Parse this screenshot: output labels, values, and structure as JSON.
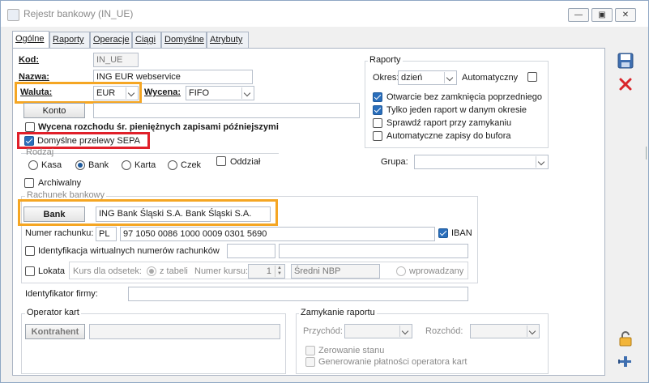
{
  "window": {
    "title": "Rejestr bankowy (IN_UE)"
  },
  "tabs": [
    "Ogólne",
    "Raporty",
    "Operacje",
    "Ciągi",
    "Domyślne",
    "Atrybuty"
  ],
  "form": {
    "kod_label": "Kod:",
    "kod_value": "IN_UE",
    "nazwa_label": "Nazwa:",
    "nazwa_value": "ING EUR webservice",
    "waluta_label": "Waluta:",
    "waluta_value": "EUR",
    "wycena_label": "Wycena:",
    "wycena_value": "FIFO",
    "konto_button": "Konto",
    "wycena_rozchodu_label": "Wycena rozchodu śr. pieniężnych zapisami późniejszymi",
    "domyslne_sepa_label": "Domyślne przelewy SEPA",
    "rodzaj_label": "Rodzaj",
    "rodzaj_options": [
      "Kasa",
      "Bank",
      "Karta",
      "Czek"
    ],
    "rodzaj_selected": "Bank",
    "oddzial_label": "Oddział",
    "archiwalny_label": "Archiwalny",
    "rachunek_group": "Rachunek bankowy",
    "bank_button": "Bank",
    "bank_value": "ING Bank Śląski S.A. Bank Śląski S.A.",
    "numer_rachunku_label": "Numer rachunku:",
    "numer_country": "PL",
    "numer_value": "97 1050 0086 1000 0009 0301 5690",
    "iban_label": "IBAN",
    "identyfikacja_label": "Identyfikacja wirtualnych numerów rachunków",
    "lokata_label": "Lokata",
    "kurs_dla_odsetek_label": "Kurs dla odsetek:",
    "z_tabeli_label": "z tabeli",
    "numer_kursu_label": "Numer kursu:",
    "numer_kursu_value": "1",
    "sredni_nbp": "Średni NBP",
    "wprowadzany_label": "wprowadzany",
    "identyfikator_firmy_label": "Identyfikator firmy:",
    "identyfikator_firmy_value": ""
  },
  "raporty": {
    "group_title": "Raporty",
    "okres_label": "Okres:",
    "okres_value": "dzień",
    "automatyczny_label": "Automatyczny",
    "otwarcie_label": "Otwarcie bez zamknięcia poprzedniego",
    "tylko_jeden_label": "Tylko jeden raport w danym okresie",
    "sprawdz_label": "Sprawdź raport przy zamykaniu",
    "automatyczne_zapisy_label": "Automatyczne zapisy do bufora",
    "grupa_label": "Grupa:"
  },
  "operator_kart": {
    "group_title": "Operator kart",
    "kontrahent_button": "Kontrahent"
  },
  "zamykanie": {
    "group_title": "Zamykanie raportu",
    "przychod_label": "Przychód:",
    "rozchod_label": "Rozchód:",
    "zerowanie_label": "Zerowanie stanu",
    "generowanie_label": "Generowanie płatności operatora kart"
  },
  "colors": {
    "highlight_orange": "#f5a623",
    "highlight_red": "#e0202a",
    "checkbox_blue": "#2a6ebb"
  }
}
